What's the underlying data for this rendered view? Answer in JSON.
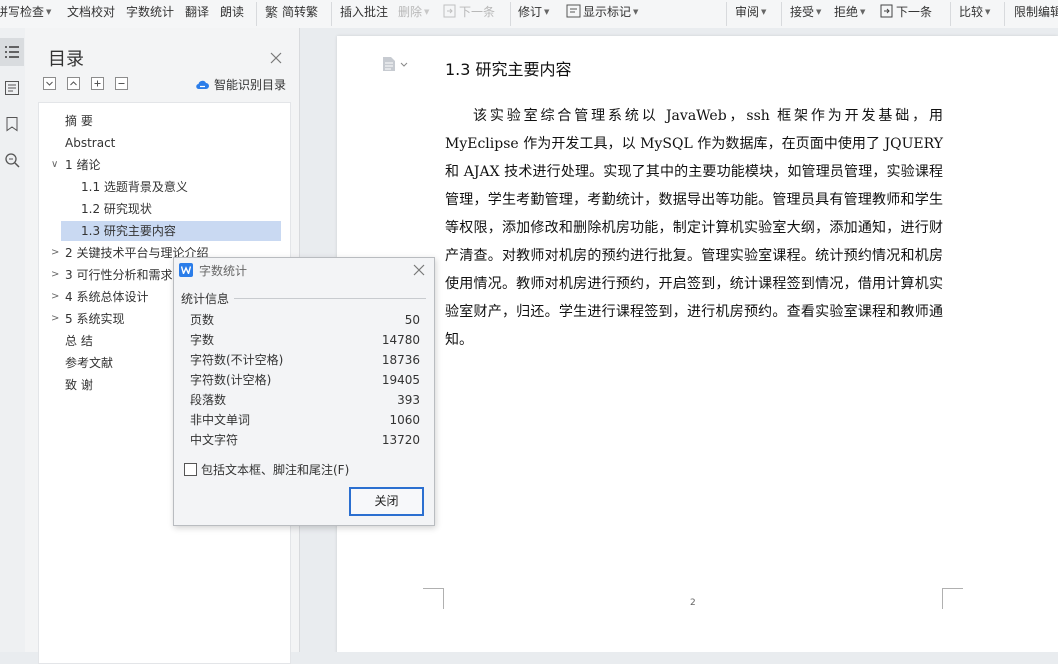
{
  "ribbon": {
    "items": [
      {
        "label": "拼写检查",
        "caret": true,
        "disabled": false
      },
      {
        "label": "文档校对",
        "caret": false,
        "disabled": false
      },
      {
        "label": "字数统计",
        "caret": false,
        "disabled": false
      },
      {
        "label": "翻译",
        "caret": false,
        "disabled": false
      },
      {
        "label": "朗读",
        "caret": false,
        "disabled": false
      },
      {
        "label": "简转繁",
        "caret": false,
        "disabled": false
      },
      {
        "label": "插入批注",
        "caret": false,
        "disabled": false
      },
      {
        "label": "删除",
        "caret": true,
        "disabled": true
      },
      {
        "label": "下一条",
        "caret": false,
        "disabled": true
      },
      {
        "label": "修订",
        "caret": true,
        "disabled": false
      },
      {
        "label": "显示标记",
        "caret": true,
        "disabled": false
      },
      {
        "label": "审阅",
        "caret": true,
        "disabled": false
      },
      {
        "label": "接受",
        "caret": true,
        "disabled": false
      },
      {
        "label": "拒绝",
        "caret": true,
        "disabled": false
      },
      {
        "label": "下一条",
        "caret": false,
        "disabled": false
      },
      {
        "label": "比较",
        "caret": true,
        "disabled": false
      },
      {
        "label": "限制编辑",
        "caret": false,
        "disabled": false
      }
    ],
    "caret_glyph": "▼"
  },
  "nav": {
    "title": "目录",
    "smart_toc": "智能识别目录",
    "toc": [
      {
        "label": "摘 要",
        "level": 1,
        "arrow": ""
      },
      {
        "label": "Abstract",
        "level": 1,
        "arrow": ""
      },
      {
        "label": "1 绪论",
        "level": 1,
        "arrow": "∨"
      },
      {
        "label": "1.1 选题背景及意义",
        "level": 2,
        "arrow": ""
      },
      {
        "label": "1.2 研究现状",
        "level": 2,
        "arrow": ""
      },
      {
        "label": "1.3 研究主要内容",
        "level": 2,
        "arrow": "",
        "selected": true
      },
      {
        "label": "2 关键技术平台与理论介绍",
        "level": 1,
        "arrow": ">"
      },
      {
        "label": "3 可行性分析和需求",
        "level": 1,
        "arrow": ">"
      },
      {
        "label": "4 系统总体设计",
        "level": 1,
        "arrow": ">"
      },
      {
        "label": "5 系统实现",
        "level": 1,
        "arrow": ">"
      },
      {
        "label": "总 结",
        "level": 1,
        "arrow": ""
      },
      {
        "label": "参考文献",
        "level": 1,
        "arrow": ""
      },
      {
        "label": "致 谢",
        "level": 1,
        "arrow": ""
      }
    ]
  },
  "document": {
    "heading": "1.3 研究主要内容",
    "body": "该实验室综合管理系统以 JavaWeb，ssh 框架作为开发基础，用 MyEclipse 作为开发工具，以 MySQL 作为数据库，在页面中使用了 JQUERY 和 AJAX 技术进行处理。实现了其中的主要功能模块，如管理员管理，实验课程管理，学生考勤管理，考勤统计，数据导出等功能。管理员具有管理教师和学生等权限，添加修改和删除机房功能，制定计算机实验室大纲，添加通知，进行财产清查。对教师对机房的预约进行批复。管理实验室课程。统计预约情况和机房使用情况。教师对机房进行预约，开启签到，统计课程签到情况，借用计算机实验室财产，归还。学生进行课程签到，进行机房预约。查看实验室课程和教师通知。",
    "page_number": "2"
  },
  "dialog": {
    "title": "字数统计",
    "group_label": "统计信息",
    "stats": [
      {
        "label": "页数",
        "value": "50"
      },
      {
        "label": "字数",
        "value": "14780"
      },
      {
        "label": "字符数(不计空格)",
        "value": "18736"
      },
      {
        "label": "字符数(计空格)",
        "value": "19405"
      },
      {
        "label": "段落数",
        "value": "393"
      },
      {
        "label": "非中文单词",
        "value": "1060"
      },
      {
        "label": "中文字符",
        "value": "13720"
      }
    ],
    "checkbox_label": "包括文本框、脚注和尾注(F)",
    "checkbox_checked": false,
    "close_button": "关闭"
  }
}
